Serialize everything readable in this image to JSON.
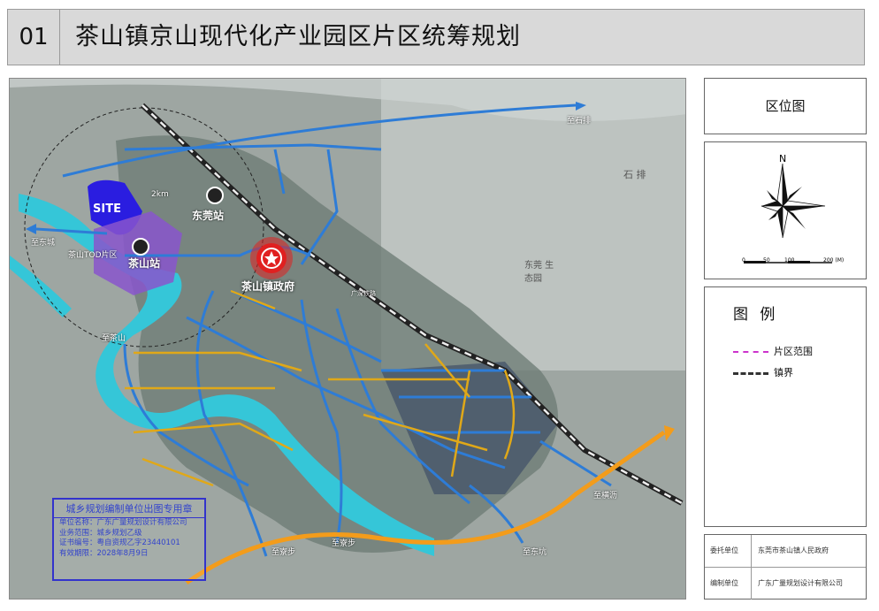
{
  "header": {
    "number": "01",
    "title": "茶山镇京山现代化产业园区片区统筹规划"
  },
  "map": {
    "labels": {
      "site": "SITE",
      "gov": "茶山镇政府",
      "dongguan_station": "东莞站",
      "chashan_station": "茶山站",
      "tod": "茶山TOD片区",
      "dist_2km": "2km",
      "to_shipai": "至石排",
      "to_dongcheng": "至东城",
      "to_hengli": "至横沥",
      "to_liaobu_1": "至寮步",
      "to_liaobu_2": "至寮步",
      "to_dongkeng": "至东坑",
      "to_xinkeng": "至茶山",
      "shipai": "石 排",
      "dongguan_eco": "东莞 生态园",
      "guangshen_rail": "广深铁路"
    },
    "stamp": {
      "title": "城乡规划编制单位出图专用章",
      "unit": "单位名称：广东广量规划设计有限公司",
      "scope": "业务范围：城乡规划乙级",
      "cert": "证书编号：粤自资规乙字23440101",
      "valid": "有效期限：2028年8月9日"
    }
  },
  "sidebar": {
    "location_title": "区位图",
    "north": "N",
    "scale": [
      "0",
      "50",
      "100",
      "200 (M)"
    ],
    "legend_title": "图 例",
    "legend": [
      {
        "label": "片区范围",
        "color": "#cc33cc"
      },
      {
        "label": "镇界",
        "color": "#333333"
      }
    ],
    "info": [
      {
        "key": "委托单位",
        "value": "东莞市茶山镇人民政府"
      },
      {
        "key": "编制单位",
        "value": "广东广量规划设计有限公司"
      }
    ]
  }
}
